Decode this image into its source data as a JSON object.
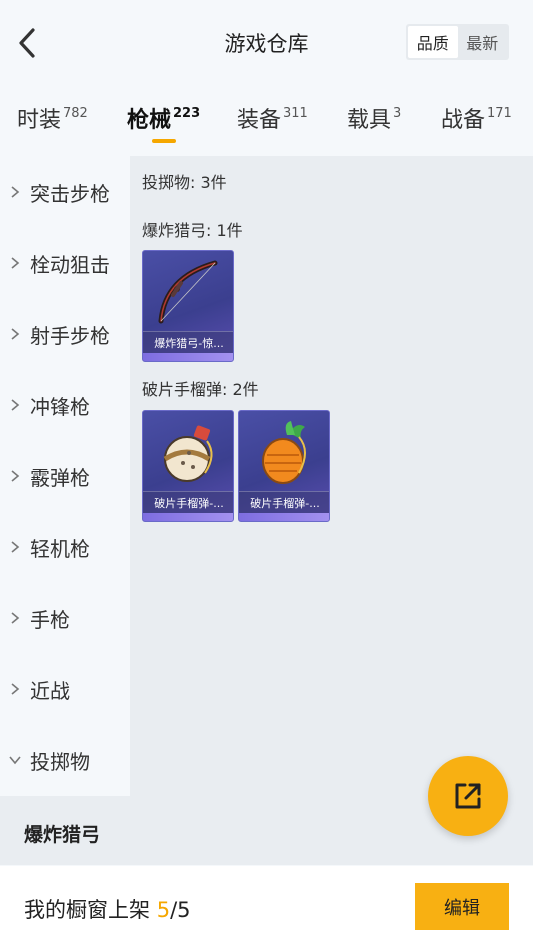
{
  "header": {
    "title": "游戏仓库",
    "back_icon": "chevron-left-icon",
    "sort": {
      "quality": "品质",
      "latest": "最新",
      "selected": "quality"
    }
  },
  "tabs": [
    {
      "label": "时装",
      "count": "782"
    },
    {
      "label": "枪械",
      "count": "223",
      "active": true
    },
    {
      "label": "装备",
      "count": "311"
    },
    {
      "label": "载具",
      "count": "3"
    },
    {
      "label": "战备",
      "count": "171"
    }
  ],
  "sidebar": {
    "items": [
      {
        "label": "突击步枪",
        "icon": "chevron-right-icon"
      },
      {
        "label": "栓动狙击",
        "icon": "chevron-right-icon"
      },
      {
        "label": "射手步枪",
        "icon": "chevron-right-icon"
      },
      {
        "label": "冲锋枪",
        "icon": "chevron-right-icon"
      },
      {
        "label": "霰弹枪",
        "icon": "chevron-right-icon"
      },
      {
        "label": "轻机枪",
        "icon": "chevron-right-icon"
      },
      {
        "label": "手枪",
        "icon": "chevron-right-icon"
      },
      {
        "label": "近战",
        "icon": "chevron-right-icon"
      },
      {
        "label": "投掷物",
        "icon": "chevron-down-icon",
        "expanded": true
      }
    ],
    "selected_sub": "爆炸猎弓"
  },
  "content": {
    "category_header": "投掷物: 3件",
    "groups": [
      {
        "title": "爆炸猎弓: 1件",
        "items": [
          {
            "name": "爆炸猎弓-惊...",
            "icon": "bow-icon"
          }
        ]
      },
      {
        "title": "破片手榴弹: 2件",
        "items": [
          {
            "name": "破片手榴弹-...",
            "icon": "grenade-icon"
          },
          {
            "name": "破片手榴弹-...",
            "icon": "carrot-grenade-icon"
          }
        ]
      }
    ]
  },
  "fab": {
    "icon": "external-link-icon"
  },
  "footer": {
    "label": "我的橱窗上架",
    "current": "5",
    "sep": "/",
    "total": "5",
    "edit": "编辑"
  },
  "colors": {
    "accent": "#f8b012",
    "card": "#3b3f8f"
  }
}
